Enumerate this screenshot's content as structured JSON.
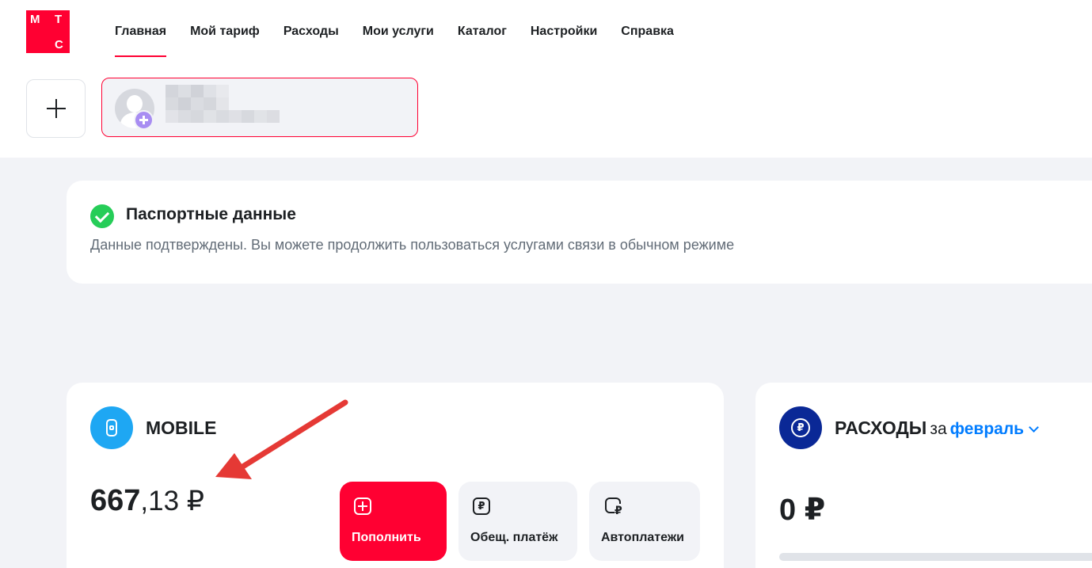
{
  "logo": {
    "letters": [
      "М",
      "Т",
      "С"
    ]
  },
  "nav": {
    "items": [
      "Главная",
      "Мой тариф",
      "Расходы",
      "Мои услуги",
      "Каталог",
      "Настройки",
      "Справка"
    ],
    "active_index": 0
  },
  "account": {
    "add_icon": "plus-icon",
    "avatar_icon": "user-avatar-icon",
    "badge_icon": "plus-badge-icon"
  },
  "passport": {
    "title": "Паспортные данные",
    "text": "Данные подтверждены. Вы можете продолжить пользоваться услугами связи в обычном режиме",
    "icon": "check-circle-icon",
    "icon_color": "#26cd58"
  },
  "mobile": {
    "title": "MOBILE",
    "balance_int": "667",
    "balance_frac": ",13",
    "currency": " ₽",
    "actions": {
      "topup": "Пополнить",
      "promise": "Обещ. платёж",
      "auto": "Автоплатежи"
    }
  },
  "expenses": {
    "title": "РАСХОДЫ",
    "for": "за",
    "month": "февраль",
    "amount": "0 ₽"
  },
  "colors": {
    "brand": "#ff0032",
    "link": "#007cff",
    "background": "#f2f3f7"
  }
}
